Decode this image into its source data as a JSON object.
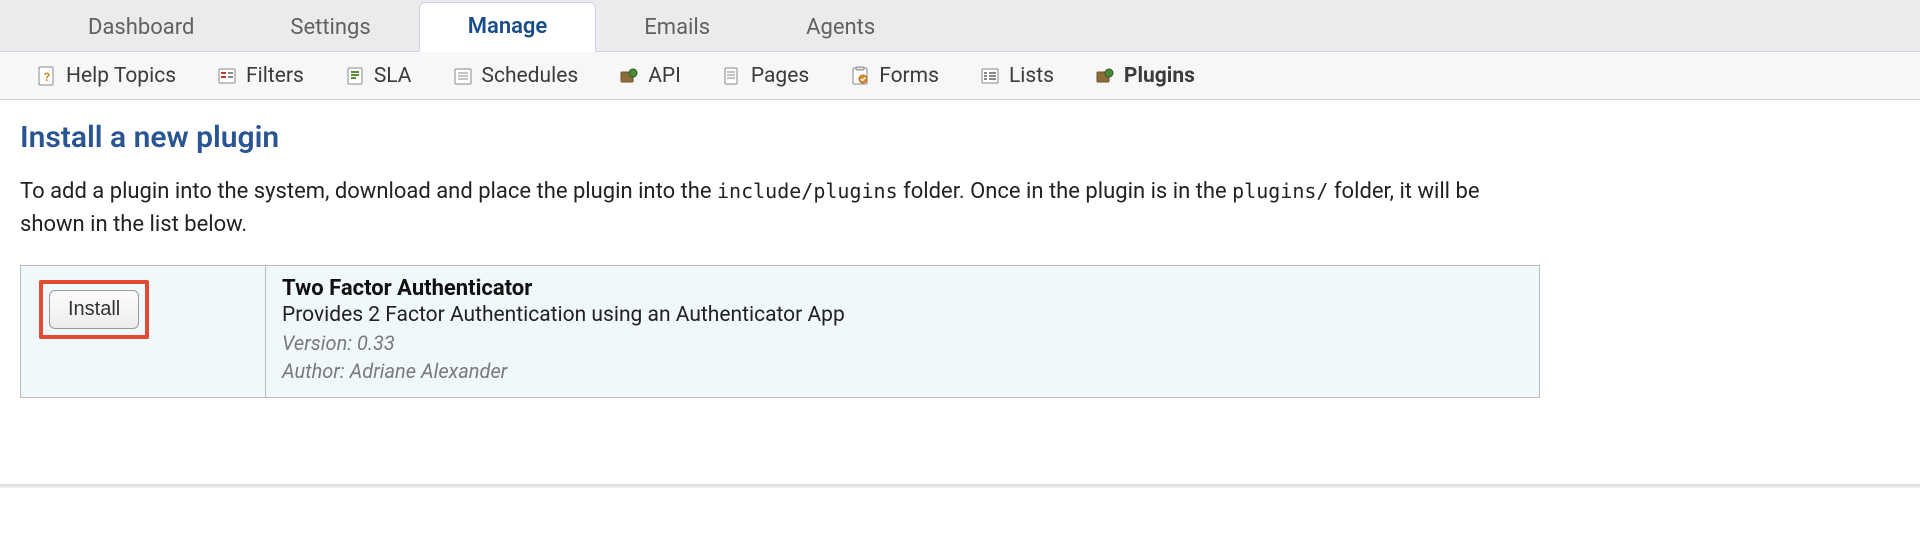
{
  "tabs": {
    "dashboard": "Dashboard",
    "settings": "Settings",
    "manage": "Manage",
    "emails": "Emails",
    "agents": "Agents"
  },
  "subnav": {
    "help_topics": "Help Topics",
    "filters": "Filters",
    "sla": "SLA",
    "schedules": "Schedules",
    "api": "API",
    "pages": "Pages",
    "forms": "Forms",
    "lists": "Lists",
    "plugins": "Plugins"
  },
  "page": {
    "title": "Install a new plugin",
    "desc_prefix": "To add a plugin into the system, download and place the plugin into the ",
    "desc_code1": "include/plugins",
    "desc_mid": " folder. Once in the plugin is in the ",
    "desc_code2": "plugins/",
    "desc_suffix": " folder, it will be shown in the list below."
  },
  "plugin": {
    "install_label": "Install",
    "name": "Two Factor Authenticator",
    "description": "Provides 2 Factor Authentication using an Authenticator App",
    "version_label": "Version: 0.33",
    "author_label": "Author: Adriane Alexander"
  }
}
